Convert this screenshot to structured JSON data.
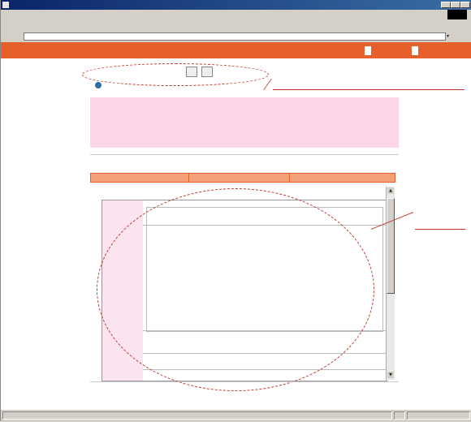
{
  "window": {
    "title": "",
    "menu": [
      "",
      "",
      "",
      "",
      "",
      ""
    ],
    "toolbar_labels": [
      "",
      "",
      "",
      "",
      ""
    ]
  },
  "address": {
    "label": "",
    "go": "",
    "value": ""
  },
  "header": {
    "title": "",
    "buttons": [
      "",
      ""
    ]
  },
  "form": {
    "buttons": [
      "",
      ""
    ]
  },
  "section": {
    "title": "",
    "lines": [
      "",
      "",
      "",
      ""
    ]
  },
  "subsection": {
    "title": ""
  },
  "tabs": [
    "",
    "",
    ""
  ],
  "result": {
    "title": ""
  },
  "left_links": [
    "",
    ""
  ],
  "items": [
    "",
    "",
    "",
    "",
    "",
    "",
    "",
    "",
    "",
    "",
    "",
    "",
    "",
    "",
    "",
    "",
    "",
    "",
    "",
    "",
    ""
  ],
  "statusbar": {
    "zone": ""
  },
  "colors": {
    "header": "#e5602a",
    "pink_box": "#fcd6e6",
    "tab_bg": "#f4a07a",
    "annotation": "#c0392b",
    "link": "#1a47a8"
  }
}
